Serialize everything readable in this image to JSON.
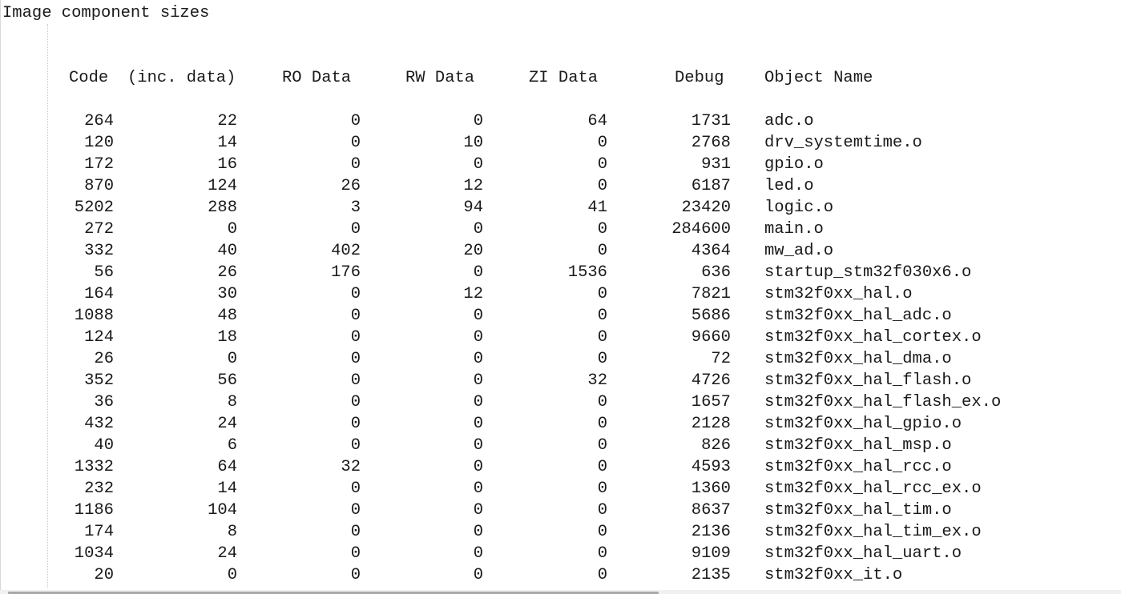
{
  "heading": "Image component sizes",
  "columns": {
    "code": "Code",
    "inc_data": "(inc. data)",
    "ro_data": "RO Data",
    "rw_data": "RW Data",
    "zi_data": "ZI Data",
    "debug": "Debug",
    "object_name": "Object Name"
  },
  "rows": [
    {
      "code": "264",
      "inc": "22",
      "ro": "0",
      "rw": "0",
      "zi": "64",
      "debug": "1731",
      "name": "adc.o"
    },
    {
      "code": "120",
      "inc": "14",
      "ro": "0",
      "rw": "10",
      "zi": "0",
      "debug": "2768",
      "name": "drv_systemtime.o"
    },
    {
      "code": "172",
      "inc": "16",
      "ro": "0",
      "rw": "0",
      "zi": "0",
      "debug": "931",
      "name": "gpio.o"
    },
    {
      "code": "870",
      "inc": "124",
      "ro": "26",
      "rw": "12",
      "zi": "0",
      "debug": "6187",
      "name": "led.o"
    },
    {
      "code": "5202",
      "inc": "288",
      "ro": "3",
      "rw": "94",
      "zi": "41",
      "debug": "23420",
      "name": "logic.o"
    },
    {
      "code": "272",
      "inc": "0",
      "ro": "0",
      "rw": "0",
      "zi": "0",
      "debug": "284600",
      "name": "main.o"
    },
    {
      "code": "332",
      "inc": "40",
      "ro": "402",
      "rw": "20",
      "zi": "0",
      "debug": "4364",
      "name": "mw_ad.o"
    },
    {
      "code": "56",
      "inc": "26",
      "ro": "176",
      "rw": "0",
      "zi": "1536",
      "debug": "636",
      "name": "startup_stm32f030x6.o"
    },
    {
      "code": "164",
      "inc": "30",
      "ro": "0",
      "rw": "12",
      "zi": "0",
      "debug": "7821",
      "name": "stm32f0xx_hal.o"
    },
    {
      "code": "1088",
      "inc": "48",
      "ro": "0",
      "rw": "0",
      "zi": "0",
      "debug": "5686",
      "name": "stm32f0xx_hal_adc.o"
    },
    {
      "code": "124",
      "inc": "18",
      "ro": "0",
      "rw": "0",
      "zi": "0",
      "debug": "9660",
      "name": "stm32f0xx_hal_cortex.o"
    },
    {
      "code": "26",
      "inc": "0",
      "ro": "0",
      "rw": "0",
      "zi": "0",
      "debug": "72",
      "name": "stm32f0xx_hal_dma.o"
    },
    {
      "code": "352",
      "inc": "56",
      "ro": "0",
      "rw": "0",
      "zi": "32",
      "debug": "4726",
      "name": "stm32f0xx_hal_flash.o"
    },
    {
      "code": "36",
      "inc": "8",
      "ro": "0",
      "rw": "0",
      "zi": "0",
      "debug": "1657",
      "name": "stm32f0xx_hal_flash_ex.o"
    },
    {
      "code": "432",
      "inc": "24",
      "ro": "0",
      "rw": "0",
      "zi": "0",
      "debug": "2128",
      "name": "stm32f0xx_hal_gpio.o"
    },
    {
      "code": "40",
      "inc": "6",
      "ro": "0",
      "rw": "0",
      "zi": "0",
      "debug": "826",
      "name": "stm32f0xx_hal_msp.o"
    },
    {
      "code": "1332",
      "inc": "64",
      "ro": "32",
      "rw": "0",
      "zi": "0",
      "debug": "4593",
      "name": "stm32f0xx_hal_rcc.o"
    },
    {
      "code": "232",
      "inc": "14",
      "ro": "0",
      "rw": "0",
      "zi": "0",
      "debug": "1360",
      "name": "stm32f0xx_hal_rcc_ex.o"
    },
    {
      "code": "1186",
      "inc": "104",
      "ro": "0",
      "rw": "0",
      "zi": "0",
      "debug": "8637",
      "name": "stm32f0xx_hal_tim.o"
    },
    {
      "code": "174",
      "inc": "8",
      "ro": "0",
      "rw": "0",
      "zi": "0",
      "debug": "2136",
      "name": "stm32f0xx_hal_tim_ex.o"
    },
    {
      "code": "1034",
      "inc": "24",
      "ro": "0",
      "rw": "0",
      "zi": "0",
      "debug": "9109",
      "name": "stm32f0xx_hal_uart.o"
    },
    {
      "code": "20",
      "inc": "0",
      "ro": "0",
      "rw": "0",
      "zi": "0",
      "debug": "2135",
      "name": "stm32f0xx_it.o"
    }
  ]
}
